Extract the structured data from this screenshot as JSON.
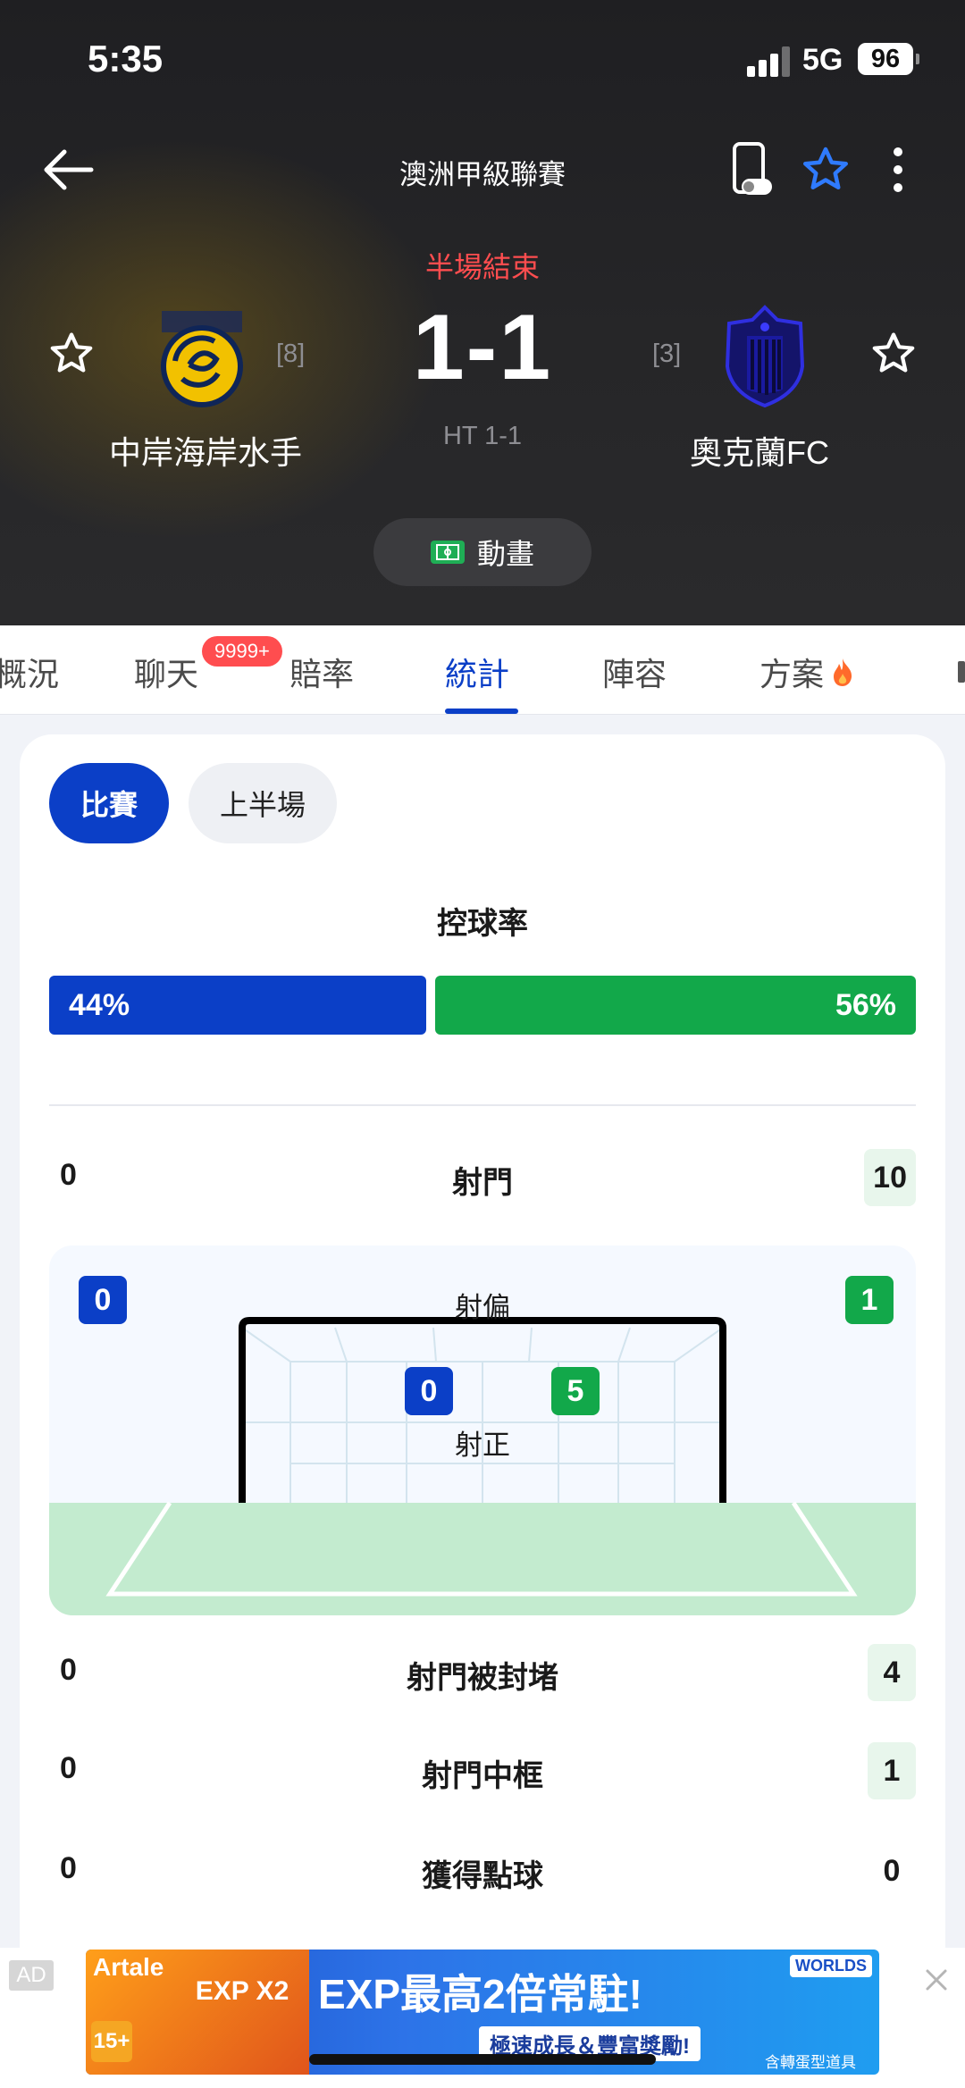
{
  "status_bar": {
    "time": "5:35",
    "network": "5G",
    "battery": "96"
  },
  "header": {
    "league": "澳洲甲級聯賽",
    "match_state": "半場結束",
    "score": "1-1",
    "halftime": "HT 1-1",
    "animation_label": "動畫",
    "home": {
      "name": "中岸海岸水手",
      "rank": "[8]"
    },
    "away": {
      "name": "奧克蘭FC",
      "rank": "[3]"
    }
  },
  "tabs": {
    "items": [
      "概況",
      "聊天",
      "賠率",
      "統計",
      "陣容",
      "方案"
    ],
    "active": "統計",
    "chat_badge": "9999+"
  },
  "stats": {
    "segments": [
      "比賽",
      "上半場"
    ],
    "possession": {
      "title": "控球率",
      "home_text": "44%",
      "away_text": "56%",
      "home_share": 0.44,
      "away_share": 0.56
    },
    "shots": {
      "label": "射門",
      "home": "0",
      "away": "10"
    },
    "off_target": {
      "label": "射偏",
      "home": "0",
      "away": "1"
    },
    "on_target": {
      "label": "射正",
      "home": "0",
      "away": "5"
    },
    "blocked": {
      "label": "射門被封堵",
      "home": "0",
      "away": "4"
    },
    "woodwork": {
      "label": "射門中框",
      "home": "0",
      "away": "1"
    },
    "penalties": {
      "label": "獲得點球",
      "home": "0",
      "away": "0"
    }
  },
  "ad": {
    "tag": "AD",
    "brand": "Artale",
    "headline": "EXP最高2倍常駐!",
    "subline": "極速成長＆豐富獎勵!",
    "badge_text": "EXP X2",
    "rating": "15+",
    "world_logo": "WORLDS",
    "footer": "含轉蛋型道具"
  },
  "colors": {
    "home": "#0b3fc7",
    "away": "#12a84a",
    "live_red": "#ff4d4f"
  }
}
